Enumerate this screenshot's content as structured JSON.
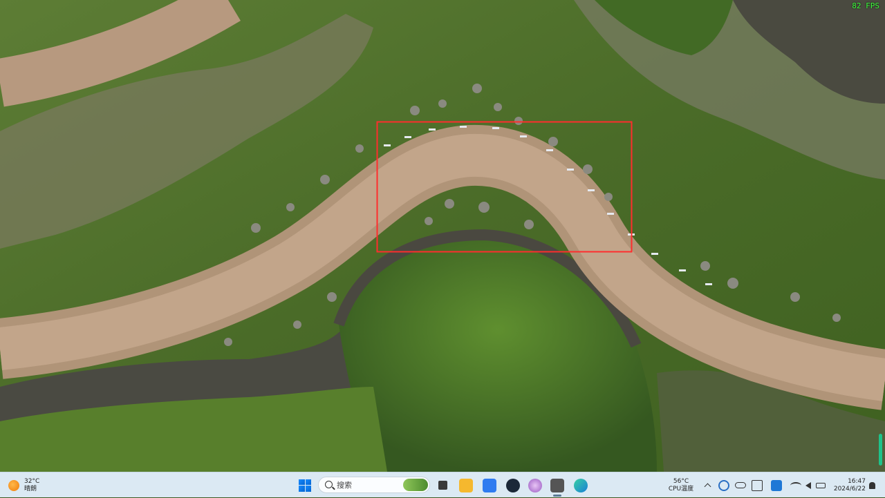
{
  "game": {
    "fps_label": "82 FPS",
    "selection_box_color": "#ff2d2d"
  },
  "taskbar": {
    "weather": {
      "temperature": "32°C",
      "condition": "晴朗"
    },
    "search": {
      "placeholder": "搜索"
    },
    "apps": [
      {
        "name": "task-view",
        "icon": "task-view-icon",
        "color": "#3a3a3a"
      },
      {
        "name": "file-explorer",
        "icon": "folder-icon",
        "color": "#f5b82e"
      },
      {
        "name": "feishu",
        "icon": "bird-icon",
        "color": "#2f7bf0"
      },
      {
        "name": "steam",
        "icon": "steam-icon",
        "color": "#1b2838"
      },
      {
        "name": "app-purple",
        "icon": "orb-icon",
        "color": "#b57bd6"
      },
      {
        "name": "game-app",
        "icon": "game-icon",
        "color": "#555555"
      },
      {
        "name": "edge",
        "icon": "edge-icon",
        "color": "#1fa0d8"
      }
    ],
    "cpu": {
      "temperature": "56°C",
      "label": "CPU温度"
    },
    "clock": {
      "time": "16:47",
      "date": "2024/6/22"
    }
  }
}
